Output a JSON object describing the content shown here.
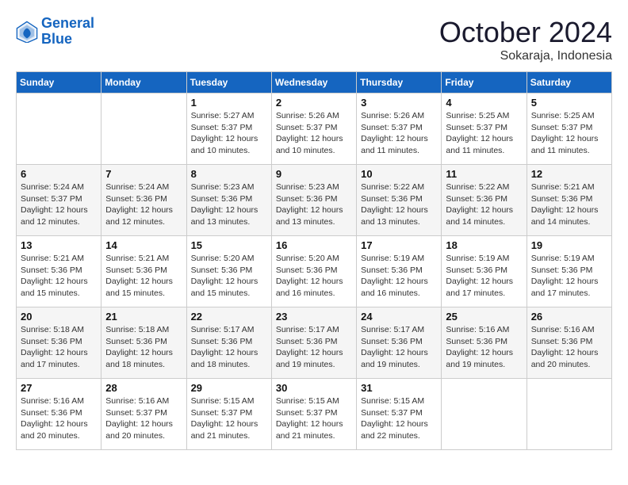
{
  "logo": {
    "line1": "General",
    "line2": "Blue"
  },
  "header": {
    "month": "October 2024",
    "location": "Sokaraja, Indonesia"
  },
  "weekdays": [
    "Sunday",
    "Monday",
    "Tuesday",
    "Wednesday",
    "Thursday",
    "Friday",
    "Saturday"
  ],
  "weeks": [
    [
      {
        "day": "",
        "sunrise": "",
        "sunset": "",
        "daylight": ""
      },
      {
        "day": "",
        "sunrise": "",
        "sunset": "",
        "daylight": ""
      },
      {
        "day": "1",
        "sunrise": "Sunrise: 5:27 AM",
        "sunset": "Sunset: 5:37 PM",
        "daylight": "Daylight: 12 hours and 10 minutes."
      },
      {
        "day": "2",
        "sunrise": "Sunrise: 5:26 AM",
        "sunset": "Sunset: 5:37 PM",
        "daylight": "Daylight: 12 hours and 10 minutes."
      },
      {
        "day": "3",
        "sunrise": "Sunrise: 5:26 AM",
        "sunset": "Sunset: 5:37 PM",
        "daylight": "Daylight: 12 hours and 11 minutes."
      },
      {
        "day": "4",
        "sunrise": "Sunrise: 5:25 AM",
        "sunset": "Sunset: 5:37 PM",
        "daylight": "Daylight: 12 hours and 11 minutes."
      },
      {
        "day": "5",
        "sunrise": "Sunrise: 5:25 AM",
        "sunset": "Sunset: 5:37 PM",
        "daylight": "Daylight: 12 hours and 11 minutes."
      }
    ],
    [
      {
        "day": "6",
        "sunrise": "Sunrise: 5:24 AM",
        "sunset": "Sunset: 5:37 PM",
        "daylight": "Daylight: 12 hours and 12 minutes."
      },
      {
        "day": "7",
        "sunrise": "Sunrise: 5:24 AM",
        "sunset": "Sunset: 5:36 PM",
        "daylight": "Daylight: 12 hours and 12 minutes."
      },
      {
        "day": "8",
        "sunrise": "Sunrise: 5:23 AM",
        "sunset": "Sunset: 5:36 PM",
        "daylight": "Daylight: 12 hours and 13 minutes."
      },
      {
        "day": "9",
        "sunrise": "Sunrise: 5:23 AM",
        "sunset": "Sunset: 5:36 PM",
        "daylight": "Daylight: 12 hours and 13 minutes."
      },
      {
        "day": "10",
        "sunrise": "Sunrise: 5:22 AM",
        "sunset": "Sunset: 5:36 PM",
        "daylight": "Daylight: 12 hours and 13 minutes."
      },
      {
        "day": "11",
        "sunrise": "Sunrise: 5:22 AM",
        "sunset": "Sunset: 5:36 PM",
        "daylight": "Daylight: 12 hours and 14 minutes."
      },
      {
        "day": "12",
        "sunrise": "Sunrise: 5:21 AM",
        "sunset": "Sunset: 5:36 PM",
        "daylight": "Daylight: 12 hours and 14 minutes."
      }
    ],
    [
      {
        "day": "13",
        "sunrise": "Sunrise: 5:21 AM",
        "sunset": "Sunset: 5:36 PM",
        "daylight": "Daylight: 12 hours and 15 minutes."
      },
      {
        "day": "14",
        "sunrise": "Sunrise: 5:21 AM",
        "sunset": "Sunset: 5:36 PM",
        "daylight": "Daylight: 12 hours and 15 minutes."
      },
      {
        "day": "15",
        "sunrise": "Sunrise: 5:20 AM",
        "sunset": "Sunset: 5:36 PM",
        "daylight": "Daylight: 12 hours and 15 minutes."
      },
      {
        "day": "16",
        "sunrise": "Sunrise: 5:20 AM",
        "sunset": "Sunset: 5:36 PM",
        "daylight": "Daylight: 12 hours and 16 minutes."
      },
      {
        "day": "17",
        "sunrise": "Sunrise: 5:19 AM",
        "sunset": "Sunset: 5:36 PM",
        "daylight": "Daylight: 12 hours and 16 minutes."
      },
      {
        "day": "18",
        "sunrise": "Sunrise: 5:19 AM",
        "sunset": "Sunset: 5:36 PM",
        "daylight": "Daylight: 12 hours and 17 minutes."
      },
      {
        "day": "19",
        "sunrise": "Sunrise: 5:19 AM",
        "sunset": "Sunset: 5:36 PM",
        "daylight": "Daylight: 12 hours and 17 minutes."
      }
    ],
    [
      {
        "day": "20",
        "sunrise": "Sunrise: 5:18 AM",
        "sunset": "Sunset: 5:36 PM",
        "daylight": "Daylight: 12 hours and 17 minutes."
      },
      {
        "day": "21",
        "sunrise": "Sunrise: 5:18 AM",
        "sunset": "Sunset: 5:36 PM",
        "daylight": "Daylight: 12 hours and 18 minutes."
      },
      {
        "day": "22",
        "sunrise": "Sunrise: 5:17 AM",
        "sunset": "Sunset: 5:36 PM",
        "daylight": "Daylight: 12 hours and 18 minutes."
      },
      {
        "day": "23",
        "sunrise": "Sunrise: 5:17 AM",
        "sunset": "Sunset: 5:36 PM",
        "daylight": "Daylight: 12 hours and 19 minutes."
      },
      {
        "day": "24",
        "sunrise": "Sunrise: 5:17 AM",
        "sunset": "Sunset: 5:36 PM",
        "daylight": "Daylight: 12 hours and 19 minutes."
      },
      {
        "day": "25",
        "sunrise": "Sunrise: 5:16 AM",
        "sunset": "Sunset: 5:36 PM",
        "daylight": "Daylight: 12 hours and 19 minutes."
      },
      {
        "day": "26",
        "sunrise": "Sunrise: 5:16 AM",
        "sunset": "Sunset: 5:36 PM",
        "daylight": "Daylight: 12 hours and 20 minutes."
      }
    ],
    [
      {
        "day": "27",
        "sunrise": "Sunrise: 5:16 AM",
        "sunset": "Sunset: 5:36 PM",
        "daylight": "Daylight: 12 hours and 20 minutes."
      },
      {
        "day": "28",
        "sunrise": "Sunrise: 5:16 AM",
        "sunset": "Sunset: 5:37 PM",
        "daylight": "Daylight: 12 hours and 20 minutes."
      },
      {
        "day": "29",
        "sunrise": "Sunrise: 5:15 AM",
        "sunset": "Sunset: 5:37 PM",
        "daylight": "Daylight: 12 hours and 21 minutes."
      },
      {
        "day": "30",
        "sunrise": "Sunrise: 5:15 AM",
        "sunset": "Sunset: 5:37 PM",
        "daylight": "Daylight: 12 hours and 21 minutes."
      },
      {
        "day": "31",
        "sunrise": "Sunrise: 5:15 AM",
        "sunset": "Sunset: 5:37 PM",
        "daylight": "Daylight: 12 hours and 22 minutes."
      },
      {
        "day": "",
        "sunrise": "",
        "sunset": "",
        "daylight": ""
      },
      {
        "day": "",
        "sunrise": "",
        "sunset": "",
        "daylight": ""
      }
    ]
  ]
}
